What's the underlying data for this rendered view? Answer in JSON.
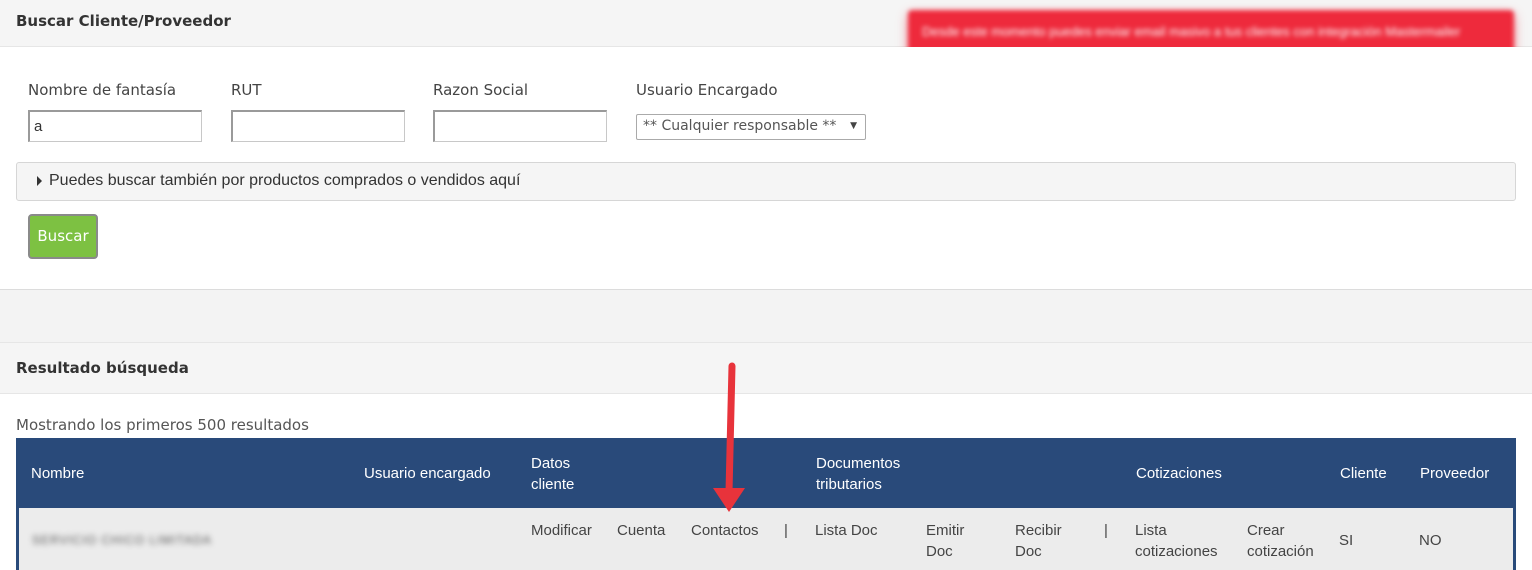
{
  "search": {
    "title": "Buscar Cliente/Proveedor",
    "notice": "Desde este momento puedes enviar email masivo a tus clientes con integración Mastermailer",
    "fields": {
      "fantasia_label": "Nombre de fantasía",
      "fantasia_value": "a",
      "rut_label": "RUT",
      "rut_value": "",
      "razon_label": "Razon Social",
      "razon_value": "",
      "usuario_label": "Usuario Encargado",
      "usuario_selected": "** Cualquier responsable **"
    },
    "products_toggle": "Puedes buscar también por productos comprados o vendidos aquí",
    "search_button": "Buscar"
  },
  "results": {
    "title": "Resultado búsqueda",
    "count_text": "Mostrando los primeros 500 resultados",
    "headers": {
      "nombre": "Nombre",
      "usuario": "Usuario encargado",
      "datos1": "Datos",
      "datos2": "cliente",
      "docs1": "Documentos",
      "docs2": "tributarios",
      "cotizaciones": "Cotizaciones",
      "cliente": "Cliente",
      "proveedor": "Proveedor"
    },
    "row": {
      "nombre": "SERVICIO CHICO LIMITADA",
      "modificar": "Modificar",
      "cuenta": "Cuenta",
      "contactos": "Contactos",
      "sep1": "|",
      "lista_doc": "Lista Doc",
      "emitir1": "Emitir",
      "emitir2": "Doc",
      "recibir1": "Recibir",
      "recibir2": "Doc",
      "sep2": "|",
      "lista_cot1": "Lista",
      "lista_cot2": "cotizaciones",
      "crear_cot1": "Crear",
      "crear_cot2": "cotización",
      "cliente": "SI",
      "proveedor": "NO"
    }
  },
  "colors": {
    "header_bg": "#294a7a",
    "button_green": "#7dc142",
    "notice_red": "#ee2a3c",
    "arrow_red": "#e8333b"
  }
}
